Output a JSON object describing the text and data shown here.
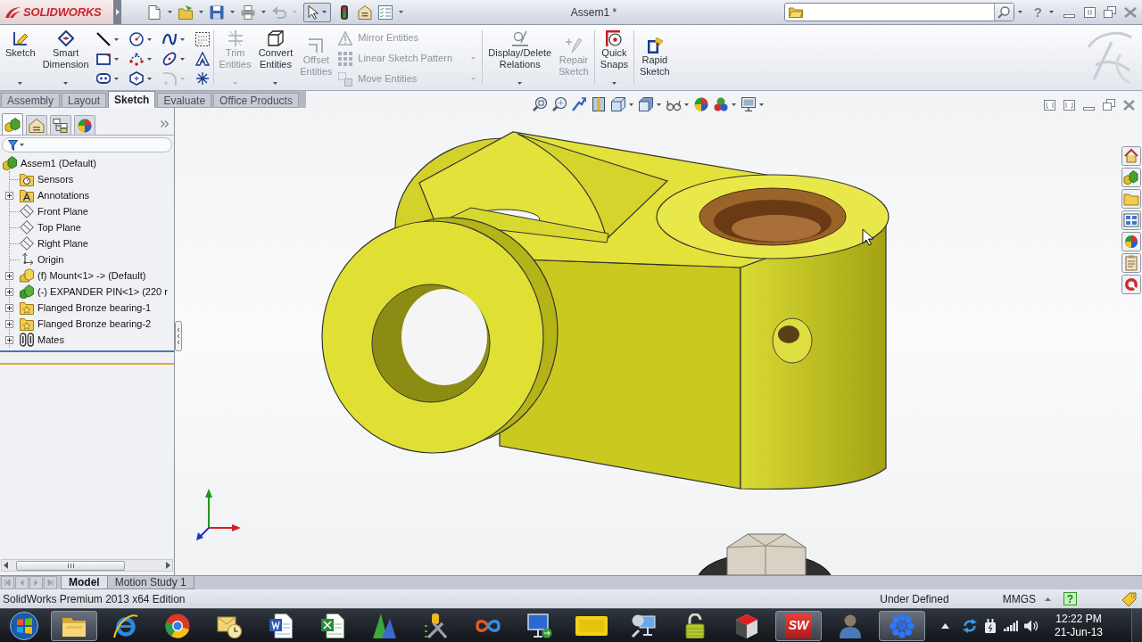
{
  "title_bar": {
    "logo": "SOLIDWORKS",
    "select_tool_pressed": true,
    "title": "Assem1 *",
    "help_glyph": "?"
  },
  "ribbon": [
    {
      "kind": "large",
      "label": "Sketch",
      "disabled": false,
      "dropdown": true
    },
    {
      "kind": "large",
      "label": "Smart Dimension",
      "disabled": false,
      "dropdown": true
    },
    {
      "kind": "sketch-tools"
    },
    {
      "kind": "separator"
    },
    {
      "kind": "large",
      "label": "Trim Entities",
      "disabled": true,
      "dropdown": true
    },
    {
      "kind": "large",
      "label": "Convert Entities",
      "disabled": false,
      "dropdown": true
    },
    {
      "kind": "large",
      "label": "Offset Entities",
      "disabled": true,
      "dropdown": false
    },
    {
      "kind": "stack",
      "items": [
        {
          "label": "Mirror Entities",
          "disabled": true,
          "dropdown": false
        },
        {
          "label": "Linear Sketch Pattern",
          "disabled": true,
          "dropdown": true
        },
        {
          "label": "Move Entities",
          "disabled": true,
          "dropdown": true
        }
      ]
    },
    {
      "kind": "separator"
    },
    {
      "kind": "large",
      "label": "Display/Delete Relations",
      "disabled": false,
      "dropdown": true
    },
    {
      "kind": "large",
      "label": "Repair Sketch",
      "disabled": true,
      "dropdown": false
    },
    {
      "kind": "separator"
    },
    {
      "kind": "large",
      "label": "Quick Snaps",
      "disabled": false,
      "dropdown": true
    },
    {
      "kind": "separator"
    },
    {
      "kind": "large",
      "label": "Rapid Sketch",
      "disabled": false,
      "dropdown": false
    }
  ],
  "command_tabs": [
    {
      "label": "Assembly",
      "selected": false
    },
    {
      "label": "Layout",
      "selected": false
    },
    {
      "label": "Sketch",
      "selected": true
    },
    {
      "label": "Evaluate",
      "selected": false
    },
    {
      "label": "Office Products",
      "selected": false
    }
  ],
  "feature_manager": {
    "panel_tabs": [
      {
        "kind": "feature-tree",
        "selected": true
      },
      {
        "kind": "property-manager",
        "selected": false
      },
      {
        "kind": "configuration-manager",
        "selected": false
      },
      {
        "kind": "display-manager",
        "selected": false
      }
    ],
    "tree": [
      {
        "kind": "assembly",
        "label": "Assem1 (Default)",
        "children": [
          {
            "kind": "sensors",
            "label": "Sensors"
          },
          {
            "kind": "annotations",
            "label": "Annotations",
            "expanded": false
          },
          {
            "kind": "plane",
            "label": "Front Plane"
          },
          {
            "kind": "plane",
            "label": "Top Plane"
          },
          {
            "kind": "plane",
            "label": "Right Plane"
          },
          {
            "kind": "origin",
            "label": "Origin"
          },
          {
            "kind": "part",
            "label": "(f) Mount<1> -> (Default)",
            "expanded": false
          },
          {
            "kind": "subassembly",
            "label": "(-) EXPANDER PIN<1> (220 r",
            "expanded": false
          },
          {
            "kind": "toolbox-part",
            "label": "Flanged Bronze bearing-1",
            "expanded": false
          },
          {
            "kind": "toolbox-part",
            "label": "Flanged Bronze bearing-2",
            "expanded": false
          },
          {
            "kind": "mates",
            "label": "Mates",
            "expanded": false
          }
        ]
      }
    ]
  },
  "bottom_tabs": [
    {
      "label": "Model",
      "selected": true
    },
    {
      "label": "Motion Study 1",
      "selected": false
    }
  ],
  "status_bar": {
    "edition": "SolidWorks Premium 2013 x64 Edition",
    "sketch_state": "Under Defined",
    "units": "MMGS",
    "help_glyph": "?"
  },
  "taskbar": {
    "apps": [
      {
        "kind": "folder",
        "active": true
      },
      {
        "kind": "e-browser",
        "active": false
      },
      {
        "kind": "round-browser",
        "active": false
      },
      {
        "kind": "mail",
        "active": false
      },
      {
        "kind": "document",
        "active": false
      },
      {
        "kind": "spreadsheet",
        "active": false
      },
      {
        "kind": "cad-2d",
        "active": false
      },
      {
        "kind": "tools",
        "active": false
      },
      {
        "kind": "loop",
        "active": false
      },
      {
        "kind": "remote",
        "active": false
      },
      {
        "kind": "card",
        "active": false
      },
      {
        "kind": "network",
        "active": false
      },
      {
        "kind": "padlock",
        "active": false
      },
      {
        "kind": "cube",
        "active": false
      },
      {
        "kind": "cad-3d",
        "glyph": "SW",
        "active": true
      },
      {
        "kind": "user",
        "active": false
      },
      {
        "kind": "snowflake",
        "active": true
      }
    ],
    "time": "12:22 PM",
    "date": "21-Jun-13"
  }
}
